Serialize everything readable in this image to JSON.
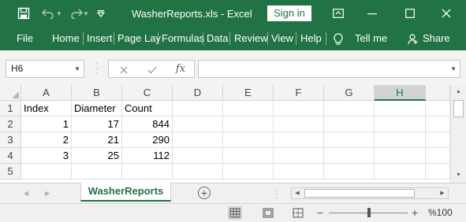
{
  "titlebar": {
    "title": "WasherReports.xls  -  Excel",
    "sign_in": "Sign in"
  },
  "ribbon": {
    "tabs": [
      "File",
      "Home",
      "Insert",
      "Page Lay",
      "Formulas",
      "Data",
      "Review",
      "View",
      "Help"
    ],
    "tell_me": "Tell me",
    "share": "Share"
  },
  "formula_bar": {
    "name_box": "H6",
    "formula": "",
    "fx": "fx"
  },
  "grid": {
    "columns": [
      "A",
      "B",
      "C",
      "D",
      "E",
      "F",
      "G",
      "H"
    ],
    "rows": [
      "1",
      "2",
      "3",
      "4",
      "5"
    ],
    "selected_column": "H",
    "cells": [
      [
        "Index",
        "Diameter",
        "Count"
      ],
      [
        "1",
        "17",
        "844"
      ],
      [
        "2",
        "21",
        "290"
      ],
      [
        "3",
        "25",
        "112"
      ]
    ]
  },
  "sheets": {
    "tabs": [
      "WasherReports"
    ],
    "add": "⊕"
  },
  "statusbar": {
    "zoom_minus": "−",
    "zoom_plus": "+",
    "zoom_level": "%100",
    "zoom_percent": 100
  },
  "colors": {
    "accent": "#217346"
  }
}
